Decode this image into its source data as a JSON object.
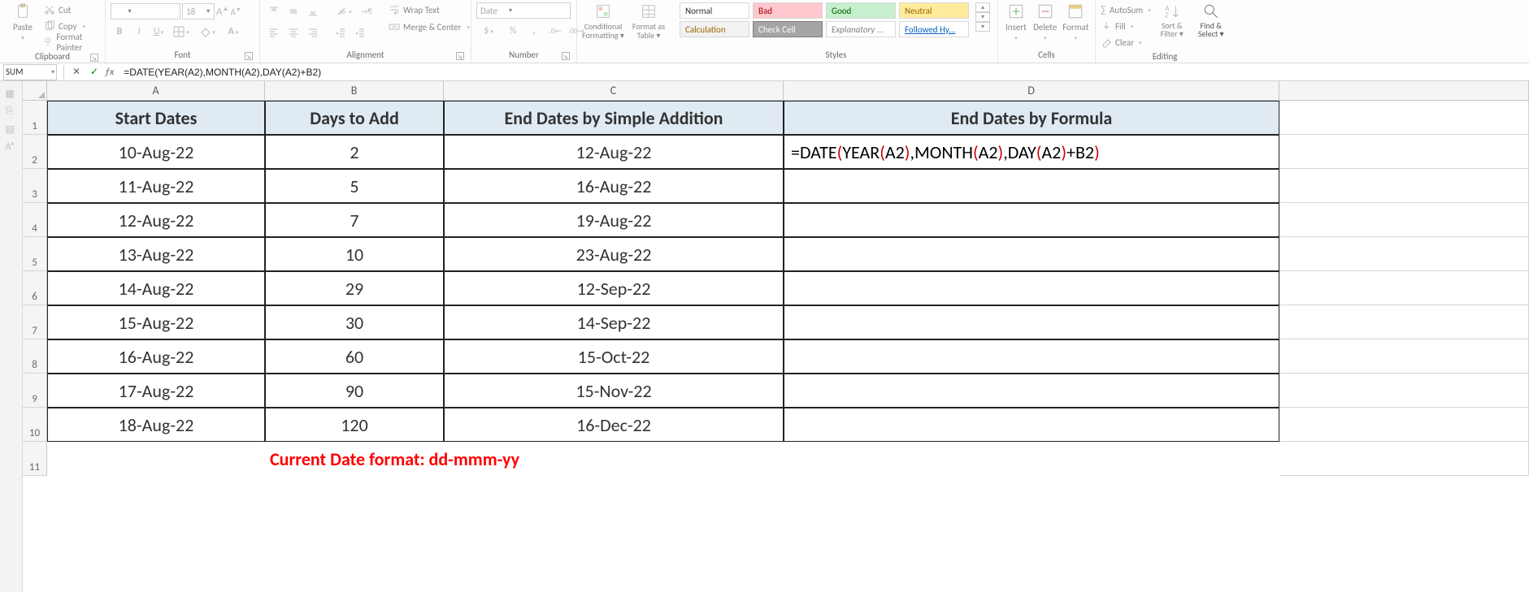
{
  "ribbon": {
    "clipboard": {
      "paste": "Paste",
      "cut": "Cut",
      "copy": "Copy",
      "format_painter": "Format Painter",
      "label": "Clipboard"
    },
    "font": {
      "size": "18",
      "label": "Font"
    },
    "alignment": {
      "wrap": "Wrap Text",
      "merge": "Merge & Center",
      "label": "Alignment"
    },
    "number": {
      "format": "Date",
      "label": "Number"
    },
    "conditional": "Conditional Formatting",
    "formatas": "Format as Table",
    "styles": {
      "normal": "Normal",
      "bad": "Bad",
      "good": "Good",
      "neutral": "Neutral",
      "calculation": "Calculation",
      "check": "Check Cell",
      "explanatory": "Explanatory ...",
      "followed": "Followed Hy...",
      "label": "Styles"
    },
    "cells": {
      "insert": "Insert",
      "delete": "Delete",
      "format": "Format",
      "label": "Cells"
    },
    "editing": {
      "autosum": "AutoSum",
      "fill": "Fill",
      "clear": "Clear",
      "sort": "Sort & Filter",
      "find": "Find & Select",
      "label": "Editing"
    }
  },
  "fbar": {
    "namebox": "SUM",
    "formula": "=DATE(YEAR(A2),MONTH(A2),DAY(A2)+B2)"
  },
  "columns": {
    "A": "A",
    "B": "B",
    "C": "C",
    "D": "D"
  },
  "headers": {
    "A": "Start Dates",
    "B": "Days to Add",
    "C": "End Dates by Simple Addition",
    "D": "End Dates by Formula"
  },
  "table": [
    {
      "r": "2",
      "A": "10-Aug-22",
      "B": "2",
      "C": "12-Aug-22"
    },
    {
      "r": "3",
      "A": "11-Aug-22",
      "B": "5",
      "C": "16-Aug-22"
    },
    {
      "r": "4",
      "A": "12-Aug-22",
      "B": "7",
      "C": "19-Aug-22"
    },
    {
      "r": "5",
      "A": "13-Aug-22",
      "B": "10",
      "C": "23-Aug-22"
    },
    {
      "r": "6",
      "A": "14-Aug-22",
      "B": "29",
      "C": "12-Sep-22"
    },
    {
      "r": "7",
      "A": "15-Aug-22",
      "B": "30",
      "C": "14-Sep-22"
    },
    {
      "r": "8",
      "A": "16-Aug-22",
      "B": "60",
      "C": "15-Oct-22"
    },
    {
      "r": "9",
      "A": "17-Aug-22",
      "B": "90",
      "C": "15-Nov-22"
    },
    {
      "r": "10",
      "A": "18-Aug-22",
      "B": "120",
      "C": "16-Dec-22"
    }
  ],
  "d2_formula": {
    "eq": "=",
    "date": "DATE",
    "lp": "(",
    "year": "YEAR",
    "a2": "A2",
    "rp": ")",
    "c": ",",
    "month": "MONTH",
    "day": "DAY",
    "plus": "+",
    "b2": "B2"
  },
  "footer_msg": "Current Date format: dd-mmm-yy",
  "row11": "11"
}
